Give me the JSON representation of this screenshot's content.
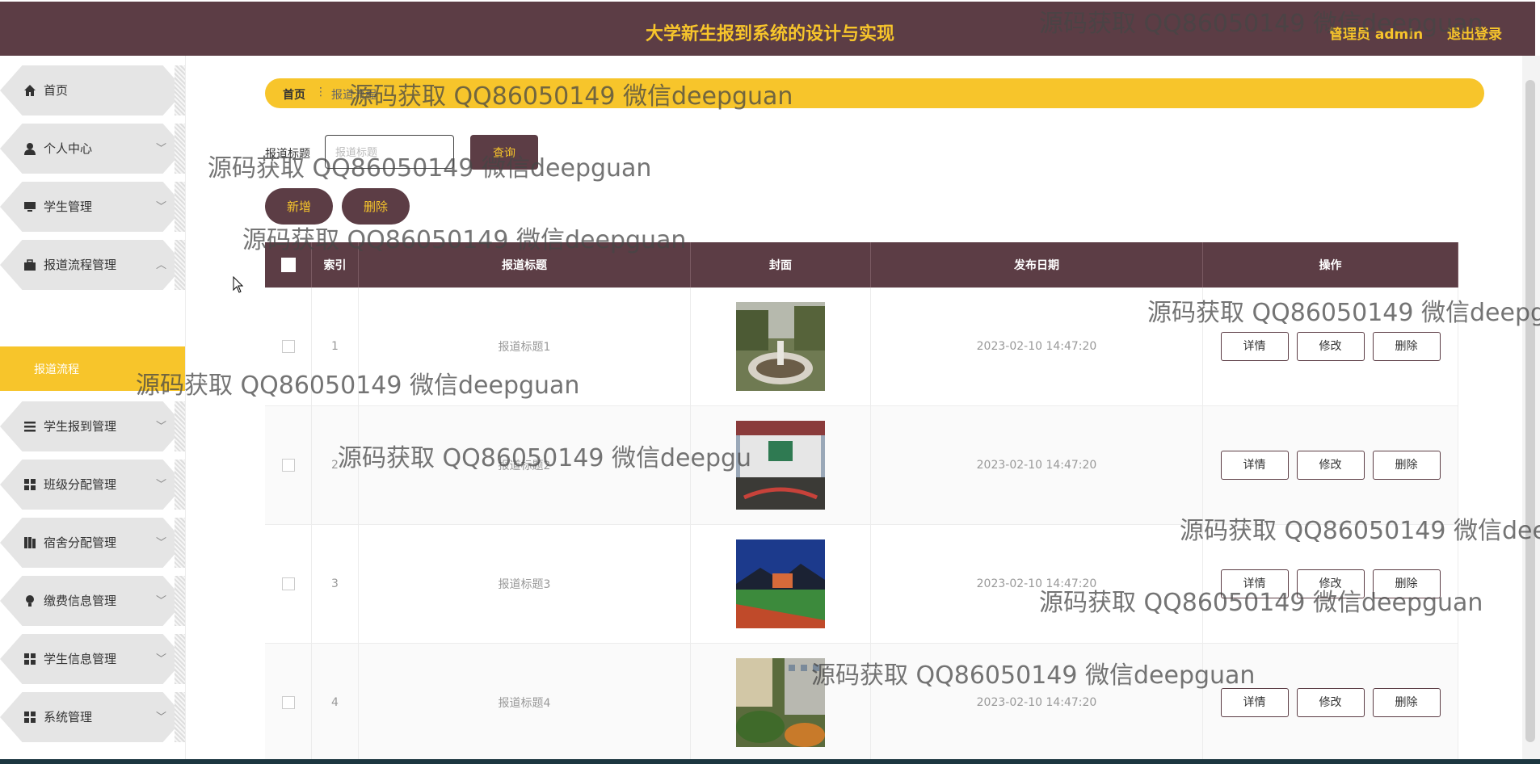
{
  "header": {
    "title": "大学新生报到系统的设计与实现",
    "user": "管理员 admin",
    "logout": "退出登录"
  },
  "sidebar": {
    "items": [
      {
        "label": "首页",
        "icon": "home-icon",
        "expand": ""
      },
      {
        "label": "个人中心",
        "icon": "user-icon",
        "expand": "﹀"
      },
      {
        "label": "学生管理",
        "icon": "monitor-icon",
        "expand": "﹀"
      },
      {
        "label": "报道流程管理",
        "icon": "briefcase-icon",
        "expand": "︿"
      },
      {
        "label": "学生报到管理",
        "icon": "list-icon",
        "expand": "﹀"
      },
      {
        "label": "班级分配管理",
        "icon": "grid-icon",
        "expand": "﹀"
      },
      {
        "label": "宿舍分配管理",
        "icon": "book-icon",
        "expand": "﹀"
      },
      {
        "label": "缴费信息管理",
        "icon": "bulb-icon",
        "expand": "﹀"
      },
      {
        "label": "学生信息管理",
        "icon": "grid-icon",
        "expand": "﹀"
      },
      {
        "label": "系统管理",
        "icon": "grid-icon",
        "expand": "﹀"
      }
    ],
    "sub_item": "报道流程"
  },
  "breadcrumb": {
    "home": "首页",
    "separator": "⋮",
    "current": "报道流程"
  },
  "search": {
    "label": "报道标题",
    "placeholder": "报道标题",
    "value": "",
    "button": "查询"
  },
  "actions": {
    "add": "新增",
    "delete": "删除"
  },
  "table": {
    "headers": {
      "index": "索引",
      "title": "报道标题",
      "cover": "封面",
      "date": "发布日期",
      "ops": "操作"
    },
    "rows": [
      {
        "index": "1",
        "title": "报道标题1",
        "date": "2023-02-10 14:47:20"
      },
      {
        "index": "2",
        "title": "报道标题2",
        "date": "2023-02-10 14:47:20"
      },
      {
        "index": "3",
        "title": "报道标题3",
        "date": "2023-02-10 14:47:20"
      },
      {
        "index": "4",
        "title": "报道标题4",
        "date": "2023-02-10 14:47:20"
      }
    ],
    "ops": {
      "detail": "详情",
      "edit": "修改",
      "delete": "删除"
    }
  },
  "watermarks": {
    "w1": "源码获取 QQ86050149 微信deepguan",
    "w2": "源码获取 QQ86050149 微信deepguan",
    "w3": "源码获取 QQ86050149 微信deepguan",
    "w4": "源码获取 QQ86050149 微信deepguan",
    "w5": "源码获取 QQ86050149 微信deepgu",
    "w6": "源码获取 QQ86050149 微信deepguan",
    "w7": "源码获取 QQ86050149 微信deepgu",
    "w8": "源码获取 QQ86050149 微信dee",
    "w9": "源码获取 QQ86050149 微信deepguan",
    "w10": "源码获取 QQ86050149 微信deepguan"
  },
  "colors": {
    "header_bg": "#5c3d45",
    "accent": "#f7c52b",
    "sidebar_item": "#e5e5e5"
  }
}
